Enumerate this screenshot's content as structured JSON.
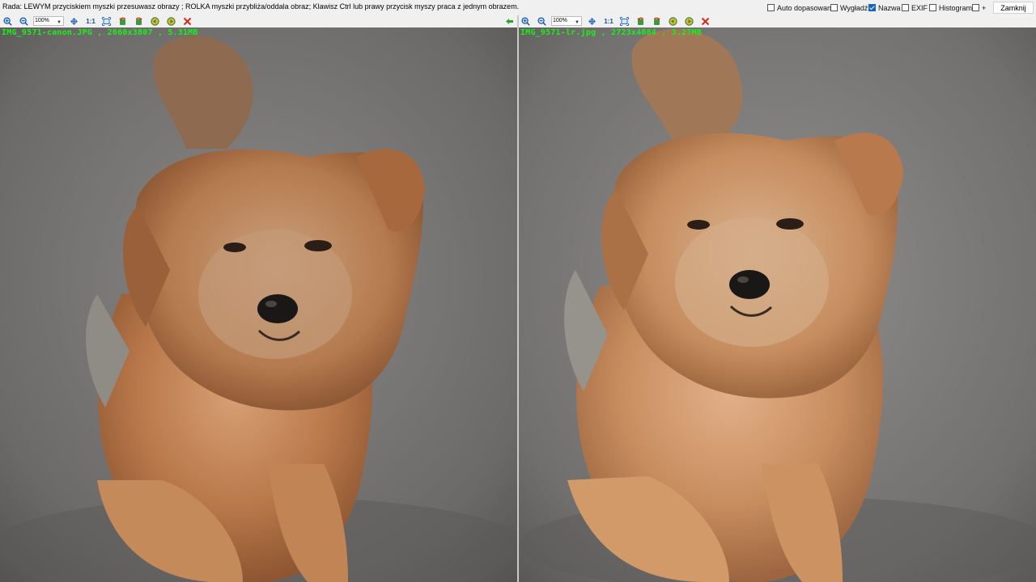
{
  "hint_text": "Rada: LEWYM przyciskiem myszki przesuwasz obrazy ; ROLKA myszki przybliża/oddala obraz; Klawisz Ctrl lub prawy przycisk myszy praca z jednym obrazem.",
  "options": [
    {
      "label": "Auto dopasowanie",
      "checked": false
    },
    {
      "label": "Wygładź",
      "checked": false
    },
    {
      "label": "Nazwa",
      "checked": true
    },
    {
      "label": "EXIF",
      "checked": false
    },
    {
      "label": "Histogram",
      "checked": false
    },
    {
      "label": "+",
      "checked": false
    }
  ],
  "close_label": "Zamknij",
  "toolbar": {
    "zoom_value": "100%",
    "one_to_one_label": "1:1",
    "icons": [
      "zoom-in-icon",
      "zoom-out-icon",
      "fit-icon",
      "actual-size-icon",
      "rotate-left-icon",
      "rotate-right-icon",
      "flip-left-icon",
      "flip-right-icon",
      "close-icon"
    ],
    "sync_icon": "green-arrow-left-icon"
  },
  "panes": {
    "left": {
      "caption": "IMG_9571-canon.JPG , 2660x3807 , 5.31MB"
    },
    "right": {
      "caption": "IMG_9571-lr.jpg , 2723x4084 , 3.27MB"
    }
  },
  "colors": {
    "caption_green": "#18f018",
    "checkbox_checked": "#1665c0",
    "close_red": "#d42a1f",
    "sync_arrow_green": "#2aa52a"
  }
}
